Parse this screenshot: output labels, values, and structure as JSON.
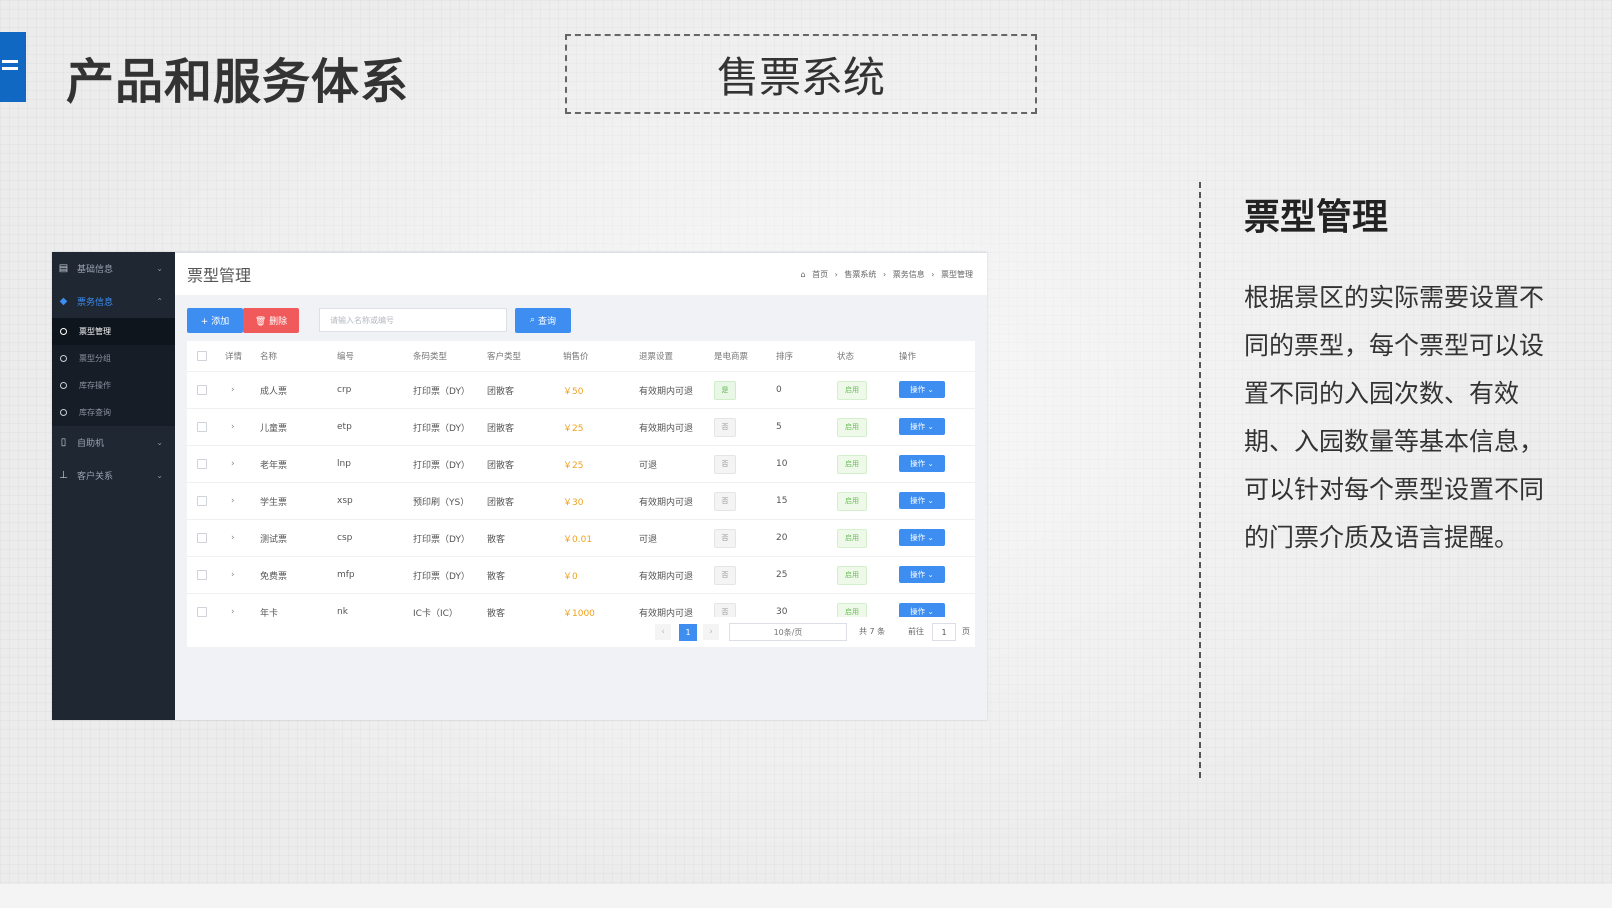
{
  "slide": {
    "title": "产品和服务体系",
    "system_label": "售票系统",
    "accent_color": "#1168c3",
    "section_title": "票型管理",
    "section_desc": "根据景区的实际需要设置不同的票型，每个票型可以设置不同的入园次数、有效期、入园数量等基本信息，可以针对每个票型设置不同的门票介质及语言提醒。"
  },
  "app": {
    "page_title": "票型管理",
    "breadcrumb": [
      "首页",
      "售票系统",
      "票务信息",
      "票型管理"
    ],
    "sidebar": {
      "items": [
        {
          "label": "基础信息",
          "icon": "document-icon"
        },
        {
          "label": "票务信息",
          "icon": "ticket-icon"
        },
        {
          "label": "自助机",
          "icon": "kiosk-icon"
        },
        {
          "label": "客户关系",
          "icon": "org-chart-icon"
        }
      ],
      "sub_items": [
        "票型管理",
        "票型分组",
        "库存操作",
        "库存查询"
      ]
    },
    "toolbar": {
      "add_label": "+ 添加",
      "delete_label": "🗑 删除",
      "search_placeholder": "请输入名称或编号",
      "query_label": "查询"
    },
    "table": {
      "headers": [
        "详情",
        "名称",
        "编号",
        "条码类型",
        "客户类型",
        "销售价",
        "退票设置",
        "是电商票",
        "排序",
        "状态",
        "操作"
      ],
      "rows": [
        {
          "name": "成人票",
          "code": "crp",
          "barcode": "打印票（DY）",
          "customer": "团散客",
          "price": "￥50",
          "refund": "有效期内可退",
          "ecommerce": "是",
          "sort": "0",
          "status": "启用",
          "action": "操作"
        },
        {
          "name": "儿童票",
          "code": "etp",
          "barcode": "打印票（DY）",
          "customer": "团散客",
          "price": "￥25",
          "refund": "有效期内可退",
          "ecommerce": "否",
          "sort": "5",
          "status": "启用",
          "action": "操作"
        },
        {
          "name": "老年票",
          "code": "lnp",
          "barcode": "打印票（DY）",
          "customer": "团散客",
          "price": "￥25",
          "refund": "可退",
          "ecommerce": "否",
          "sort": "10",
          "status": "启用",
          "action": "操作"
        },
        {
          "name": "学生票",
          "code": "xsp",
          "barcode": "预印刷（YS）",
          "customer": "团散客",
          "price": "￥30",
          "refund": "有效期内可退",
          "ecommerce": "否",
          "sort": "15",
          "status": "启用",
          "action": "操作"
        },
        {
          "name": "测试票",
          "code": "csp",
          "barcode": "打印票（DY）",
          "customer": "散客",
          "price": "￥0.01",
          "refund": "可退",
          "ecommerce": "否",
          "sort": "20",
          "status": "启用",
          "action": "操作"
        },
        {
          "name": "免费票",
          "code": "mfp",
          "barcode": "打印票（DY）",
          "customer": "散客",
          "price": "￥0",
          "refund": "有效期内可退",
          "ecommerce": "否",
          "sort": "25",
          "status": "启用",
          "action": "操作"
        },
        {
          "name": "年卡",
          "code": "nk",
          "barcode": "IC卡（IC）",
          "customer": "散客",
          "price": "￥1000",
          "refund": "有效期内可退",
          "ecommerce": "否",
          "sort": "30",
          "status": "启用",
          "action": "操作"
        }
      ]
    },
    "pagination": {
      "current": "1",
      "page_size": "10条/页",
      "total": "共 7 条",
      "goto_label": "前往",
      "goto_value": "1",
      "page_suffix": "页"
    }
  }
}
